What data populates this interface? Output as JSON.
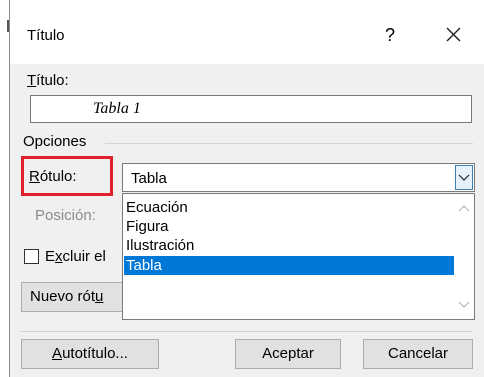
{
  "dialog": {
    "title": "Título",
    "help_label": "?",
    "titulo_label_u": "T",
    "titulo_label_rest": "ítulo:",
    "titulo_value": "Tabla 1",
    "opciones_label": "Opciones",
    "rotulo_label_u": "R",
    "rotulo_label_rest": "ótulo:",
    "rotulo_selected": "Tabla",
    "rotulo_options": [
      "Ecuación",
      "Figura",
      "Ilustración",
      "Tabla"
    ],
    "posicion_label": "Posición:",
    "excluir_label_first": "E",
    "excluir_label_u": "x",
    "excluir_label_rest": "cluir el",
    "nuevo_rotulo_label_a": "Nuevo rót",
    "nuevo_rotulo_label_u": "u",
    "autotitulo_label_u": "A",
    "autotitulo_label_rest": "utotítulo...",
    "aceptar_label": "Aceptar",
    "cancelar_label": "Cancelar"
  },
  "colors": {
    "highlight_border": "#e0202a",
    "selection": "#0078d7",
    "dialog_bg": "#f0f0f0"
  },
  "icons": {
    "close": "close-icon",
    "dropdown": "chevron-down-icon"
  }
}
